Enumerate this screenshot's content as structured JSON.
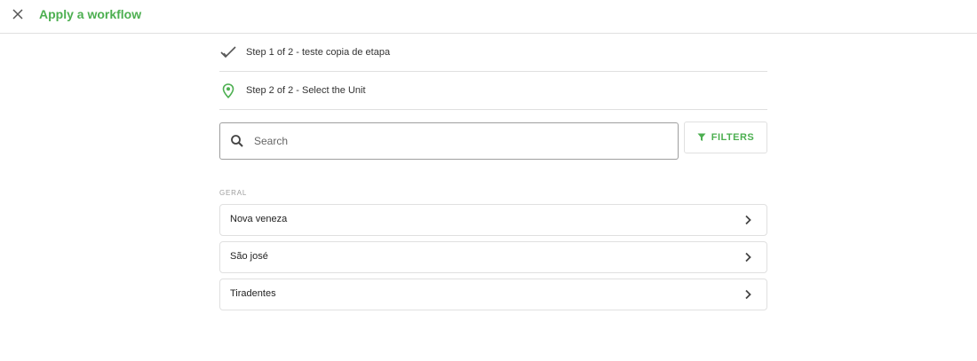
{
  "header": {
    "title": "Apply a workflow",
    "close_icon": "close-icon"
  },
  "steps": [
    {
      "label": "Step 1 of 2 - teste copia de etapa",
      "icon": "checkmark-icon",
      "status": "done"
    },
    {
      "label": "Step 2 of 2 - Select the Unit",
      "icon": "location-pin-icon",
      "status": "current"
    }
  ],
  "search": {
    "placeholder": "Search",
    "value": ""
  },
  "filters": {
    "label": "FILTERS",
    "icon": "funnel-icon"
  },
  "section": {
    "label": "GERAL"
  },
  "units": [
    {
      "name": "Nova veneza"
    },
    {
      "name": "São josé"
    },
    {
      "name": "Tiradentes"
    }
  ],
  "colors": {
    "accent": "#4caf50",
    "border": "#e0e0e0",
    "text": "#333333",
    "muted": "#9e9e9e"
  }
}
